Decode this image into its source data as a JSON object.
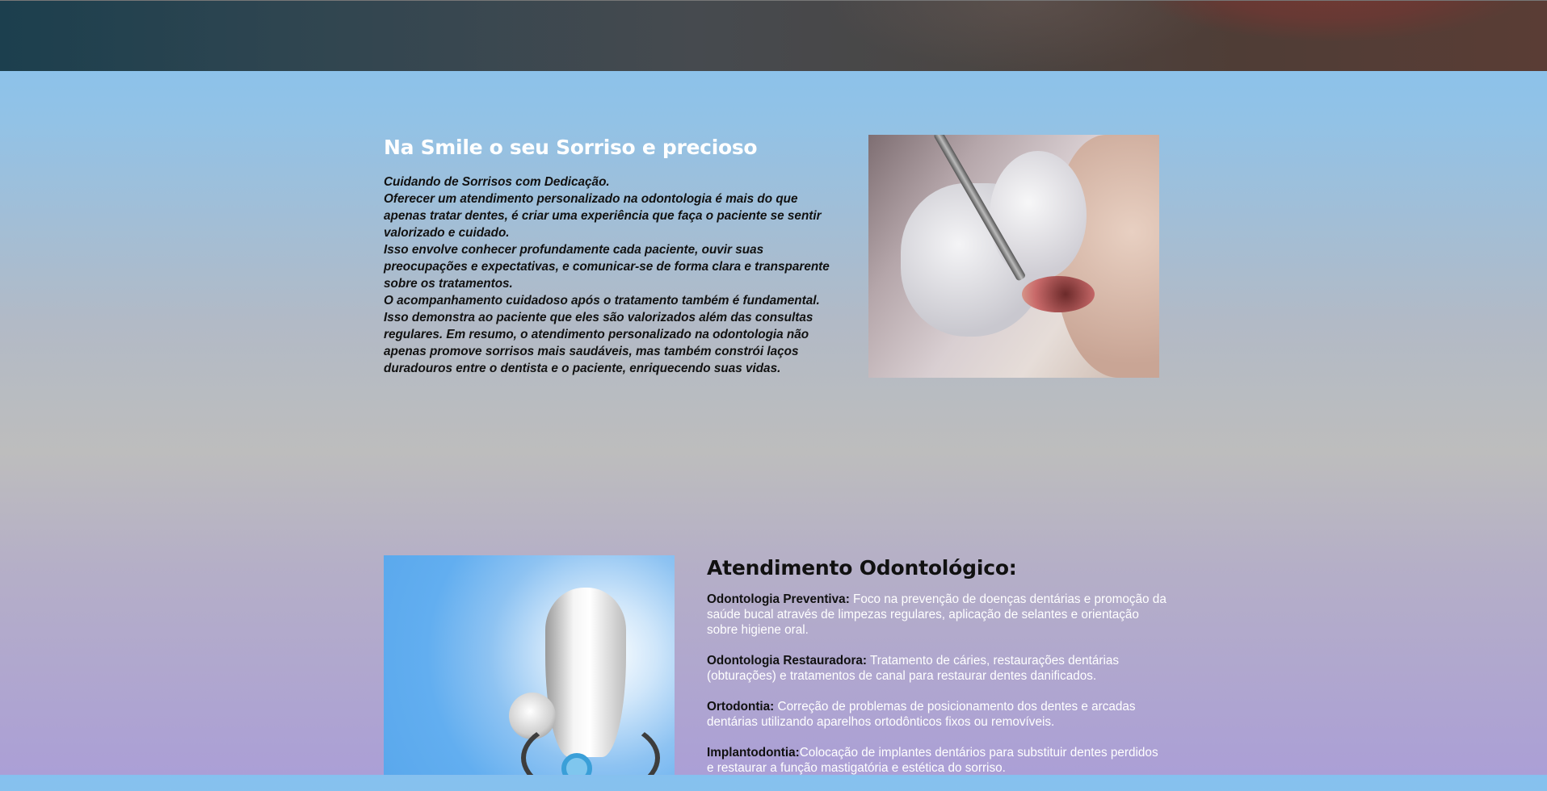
{
  "intro": {
    "title": "Na Smile o seu Sorriso e precioso",
    "paragraphs": [
      "Cuidando de Sorrisos com Dedicação.",
      "Oferecer um atendimento personalizado na odontologia é mais do que apenas tratar dentes, é criar uma experiência que faça o paciente se sentir valorizado e cuidado.",
      "Isso envolve conhecer profundamente cada paciente, ouvir suas preocupações e expectativas, e comunicar-se de forma clara e transparente sobre os tratamentos.",
      "O acompanhamento cuidadoso após o tratamento também é fundamental. Isso demonstra ao paciente que eles são valorizados além das consultas regulares. Em resumo, o atendimento personalizado na odontologia não apenas promove sorrisos mais saudáveis, mas também constrói laços duradouros entre o dentista e o paciente, enriquecendo suas vidas."
    ]
  },
  "services": {
    "title": "Atendimento Odontológico:",
    "items": [
      {
        "label": "Odontologia Preventiva:",
        "text": " Foco na prevenção de doenças dentárias e promoção da saúde bucal através de limpezas regulares, aplicação de selantes e orientação sobre higiene oral."
      },
      {
        "label": "Odontologia Restauradora:",
        "text": " Tratamento de cáries, restaurações dentárias (obturações) e tratamentos de canal para restaurar dentes danificados."
      },
      {
        "label": "Ortodontia:",
        "text": " Correção de problemas de posicionamento dos dentes e arcadas dentárias utilizando aparelhos ortodônticos fixos ou removíveis."
      },
      {
        "label": "Implantodontia:",
        "text": "Colocação de implantes dentários para substituir dentes perdidos e restaurar a função mastigatória e estética do sorriso."
      }
    ]
  }
}
